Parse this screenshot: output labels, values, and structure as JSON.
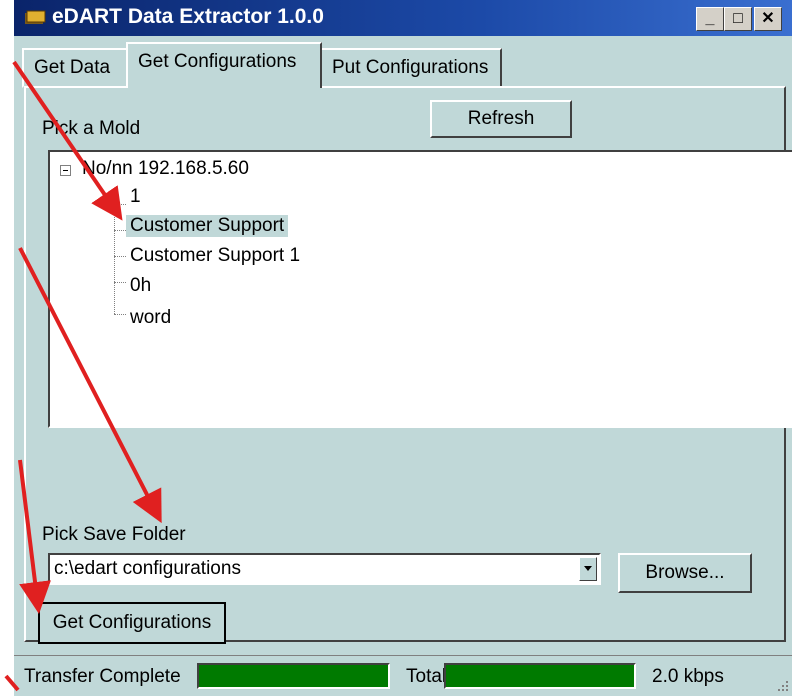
{
  "window": {
    "title": "eDART Data Extractor 1.0.0"
  },
  "title_buttons": {
    "minimize": "_",
    "maximize": "□",
    "close": "✕"
  },
  "tabs": [
    {
      "label": "Get Data",
      "active": false
    },
    {
      "label": "Get Configurations",
      "active": true
    },
    {
      "label": "Put Configurations",
      "active": false
    }
  ],
  "mold": {
    "label": "Pick a Mold",
    "refresh_label": "Refresh",
    "tree": {
      "root": "No/nn 192.168.5.60",
      "children": [
        "1",
        "Customer Support",
        "Customer Support 1",
        "0h",
        "word"
      ],
      "selected": "Customer Support"
    }
  },
  "save_folder": {
    "label": "Pick Save Folder",
    "value": "c:\\edart configurations",
    "browse_label": "Browse..."
  },
  "get_configurations_label": "Get Configurations",
  "status": {
    "transfer_label": "Transfer Complete",
    "transfer_progress": 1.0,
    "total_label": "Total",
    "total_progress": 1.0,
    "rate": "2.0 kbps"
  },
  "colors": {
    "panel": "#c0d8d8",
    "titlebar": "#0a246a",
    "progress": "#007a00",
    "annotation_arrow": "#e02020"
  }
}
